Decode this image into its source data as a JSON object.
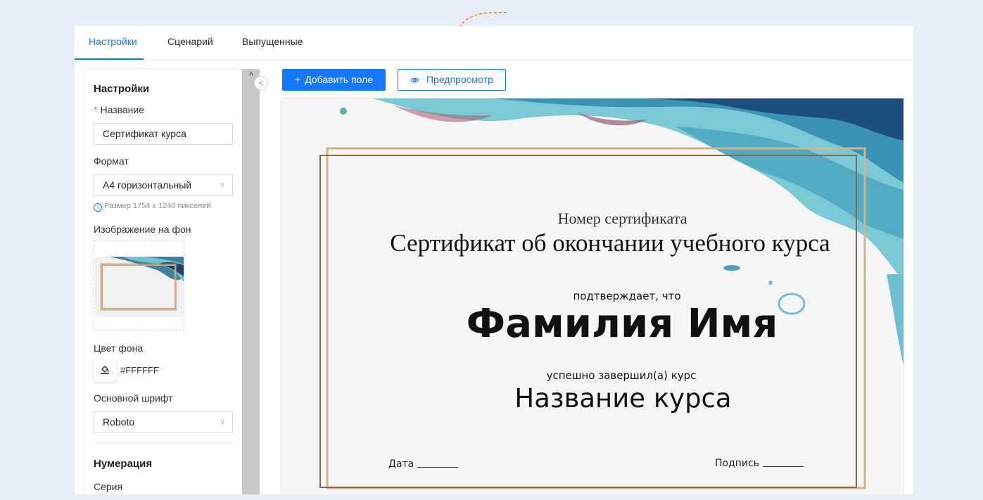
{
  "tabs": [
    {
      "label": "Настройки",
      "active": true
    },
    {
      "label": "Сценарий",
      "active": false
    },
    {
      "label": "Выпущенные",
      "active": false
    }
  ],
  "settings": {
    "title": "Настройки",
    "name_label": "Название",
    "name_required_mark": "*",
    "name_value": "Сертификат курса",
    "format_label": "Формат",
    "format_value": "А4 горизонтальный",
    "size_hint": "Размер 1754 x 1240 пикселей",
    "bg_image_label": "Изображение на фон",
    "bg_color_label": "Цвет фона",
    "bg_color_value": "#FFFFFF",
    "font_label": "Основной шрифт",
    "font_value": "Roboto",
    "numbering_title": "Нумерация",
    "series_label": "Серия"
  },
  "toolbar": {
    "add_field_label": "Добавить поле",
    "add_field_icon": "plus-icon",
    "preview_label": "Предпросмотр",
    "preview_icon": "eye-icon"
  },
  "certificate": {
    "number": "Номер сертификата",
    "title": "Сертификат об окончании учебного курса",
    "confirms": "подтверждает, что",
    "full_name": "Фамилия Имя",
    "completed": "успешно завершил(а) курс",
    "course_name": "Название курса",
    "date_label": "Дата",
    "signature_label": "Подпись"
  },
  "colors": {
    "accent": "#1677ff",
    "annotation_arrow": "#f08a24",
    "frame": "#b08a5a"
  }
}
